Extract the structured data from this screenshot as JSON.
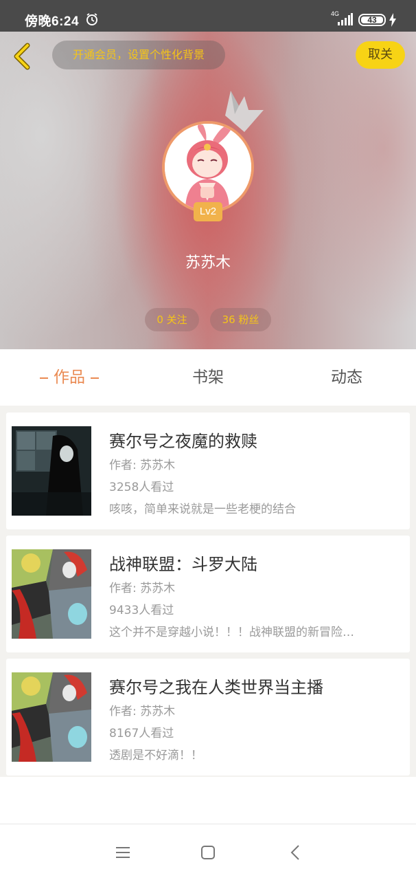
{
  "status_bar": {
    "time": "傍晚6:24",
    "network": "4G",
    "battery": "43",
    "icons": [
      "alarm-icon",
      "signal-icon",
      "battery-icon",
      "charging-icon"
    ]
  },
  "header": {
    "back_icon": "chevron-left-icon",
    "vip_banner": "开通会员，设置个性化背景",
    "follow_button": "取关",
    "crown_icon": "crown-icon",
    "level": "Lv2",
    "username": "苏苏木",
    "following": "0 关注",
    "fans": "36 粉丝"
  },
  "tabs": [
    {
      "label": "作品",
      "active": true
    },
    {
      "label": "书架",
      "active": false
    },
    {
      "label": "动态",
      "active": false
    }
  ],
  "works": [
    {
      "title": "赛尔号之夜魔的救赎",
      "author": "作者: 苏苏木",
      "views": "3258人看过",
      "description": "咳咳，简单来说就是一些老梗的结合"
    },
    {
      "title": "战神联盟：斗罗大陆",
      "author": "作者: 苏苏木",
      "views": "9433人看过",
      "description": "这个并不是穿越小说！！！战神联盟的新冒险…"
    },
    {
      "title": "赛尔号之我在人类世界当主播",
      "author": "作者: 苏苏木",
      "views": "8167人看过",
      "description": "透剧是不好滴！！"
    }
  ],
  "nav": [
    "menu-icon",
    "home-icon",
    "back-icon"
  ],
  "colors": {
    "accent": "#ea8a52",
    "vip_gold": "#f5c518",
    "follow_yellow": "#f7d315",
    "level_badge": "#f1b24b"
  }
}
